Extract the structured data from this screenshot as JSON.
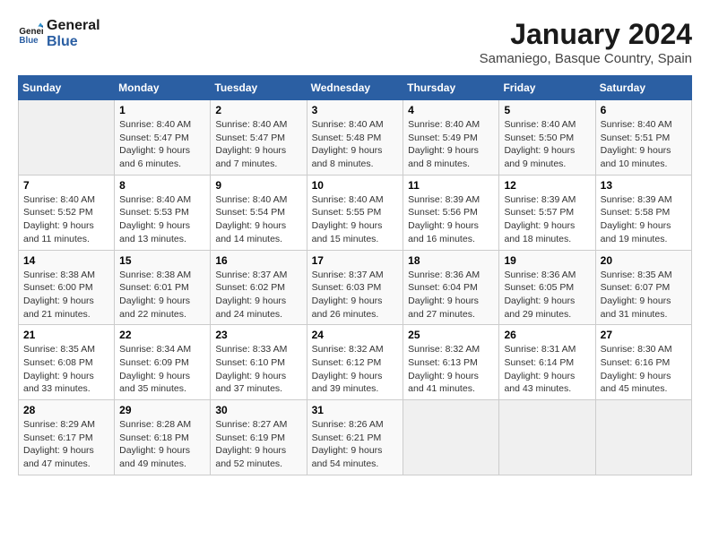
{
  "logo": {
    "line1": "General",
    "line2": "Blue"
  },
  "title": "January 2024",
  "subtitle": "Samaniego, Basque Country, Spain",
  "weekdays": [
    "Sunday",
    "Monday",
    "Tuesday",
    "Wednesday",
    "Thursday",
    "Friday",
    "Saturday"
  ],
  "weeks": [
    [
      {
        "day": "",
        "sunrise": "",
        "sunset": "",
        "daylight": ""
      },
      {
        "day": "1",
        "sunrise": "Sunrise: 8:40 AM",
        "sunset": "Sunset: 5:47 PM",
        "daylight": "Daylight: 9 hours and 6 minutes."
      },
      {
        "day": "2",
        "sunrise": "Sunrise: 8:40 AM",
        "sunset": "Sunset: 5:47 PM",
        "daylight": "Daylight: 9 hours and 7 minutes."
      },
      {
        "day": "3",
        "sunrise": "Sunrise: 8:40 AM",
        "sunset": "Sunset: 5:48 PM",
        "daylight": "Daylight: 9 hours and 8 minutes."
      },
      {
        "day": "4",
        "sunrise": "Sunrise: 8:40 AM",
        "sunset": "Sunset: 5:49 PM",
        "daylight": "Daylight: 9 hours and 8 minutes."
      },
      {
        "day": "5",
        "sunrise": "Sunrise: 8:40 AM",
        "sunset": "Sunset: 5:50 PM",
        "daylight": "Daylight: 9 hours and 9 minutes."
      },
      {
        "day": "6",
        "sunrise": "Sunrise: 8:40 AM",
        "sunset": "Sunset: 5:51 PM",
        "daylight": "Daylight: 9 hours and 10 minutes."
      }
    ],
    [
      {
        "day": "7",
        "sunrise": "Sunrise: 8:40 AM",
        "sunset": "Sunset: 5:52 PM",
        "daylight": "Daylight: 9 hours and 11 minutes."
      },
      {
        "day": "8",
        "sunrise": "Sunrise: 8:40 AM",
        "sunset": "Sunset: 5:53 PM",
        "daylight": "Daylight: 9 hours and 13 minutes."
      },
      {
        "day": "9",
        "sunrise": "Sunrise: 8:40 AM",
        "sunset": "Sunset: 5:54 PM",
        "daylight": "Daylight: 9 hours and 14 minutes."
      },
      {
        "day": "10",
        "sunrise": "Sunrise: 8:40 AM",
        "sunset": "Sunset: 5:55 PM",
        "daylight": "Daylight: 9 hours and 15 minutes."
      },
      {
        "day": "11",
        "sunrise": "Sunrise: 8:39 AM",
        "sunset": "Sunset: 5:56 PM",
        "daylight": "Daylight: 9 hours and 16 minutes."
      },
      {
        "day": "12",
        "sunrise": "Sunrise: 8:39 AM",
        "sunset": "Sunset: 5:57 PM",
        "daylight": "Daylight: 9 hours and 18 minutes."
      },
      {
        "day": "13",
        "sunrise": "Sunrise: 8:39 AM",
        "sunset": "Sunset: 5:58 PM",
        "daylight": "Daylight: 9 hours and 19 minutes."
      }
    ],
    [
      {
        "day": "14",
        "sunrise": "Sunrise: 8:38 AM",
        "sunset": "Sunset: 6:00 PM",
        "daylight": "Daylight: 9 hours and 21 minutes."
      },
      {
        "day": "15",
        "sunrise": "Sunrise: 8:38 AM",
        "sunset": "Sunset: 6:01 PM",
        "daylight": "Daylight: 9 hours and 22 minutes."
      },
      {
        "day": "16",
        "sunrise": "Sunrise: 8:37 AM",
        "sunset": "Sunset: 6:02 PM",
        "daylight": "Daylight: 9 hours and 24 minutes."
      },
      {
        "day": "17",
        "sunrise": "Sunrise: 8:37 AM",
        "sunset": "Sunset: 6:03 PM",
        "daylight": "Daylight: 9 hours and 26 minutes."
      },
      {
        "day": "18",
        "sunrise": "Sunrise: 8:36 AM",
        "sunset": "Sunset: 6:04 PM",
        "daylight": "Daylight: 9 hours and 27 minutes."
      },
      {
        "day": "19",
        "sunrise": "Sunrise: 8:36 AM",
        "sunset": "Sunset: 6:05 PM",
        "daylight": "Daylight: 9 hours and 29 minutes."
      },
      {
        "day": "20",
        "sunrise": "Sunrise: 8:35 AM",
        "sunset": "Sunset: 6:07 PM",
        "daylight": "Daylight: 9 hours and 31 minutes."
      }
    ],
    [
      {
        "day": "21",
        "sunrise": "Sunrise: 8:35 AM",
        "sunset": "Sunset: 6:08 PM",
        "daylight": "Daylight: 9 hours and 33 minutes."
      },
      {
        "day": "22",
        "sunrise": "Sunrise: 8:34 AM",
        "sunset": "Sunset: 6:09 PM",
        "daylight": "Daylight: 9 hours and 35 minutes."
      },
      {
        "day": "23",
        "sunrise": "Sunrise: 8:33 AM",
        "sunset": "Sunset: 6:10 PM",
        "daylight": "Daylight: 9 hours and 37 minutes."
      },
      {
        "day": "24",
        "sunrise": "Sunrise: 8:32 AM",
        "sunset": "Sunset: 6:12 PM",
        "daylight": "Daylight: 9 hours and 39 minutes."
      },
      {
        "day": "25",
        "sunrise": "Sunrise: 8:32 AM",
        "sunset": "Sunset: 6:13 PM",
        "daylight": "Daylight: 9 hours and 41 minutes."
      },
      {
        "day": "26",
        "sunrise": "Sunrise: 8:31 AM",
        "sunset": "Sunset: 6:14 PM",
        "daylight": "Daylight: 9 hours and 43 minutes."
      },
      {
        "day": "27",
        "sunrise": "Sunrise: 8:30 AM",
        "sunset": "Sunset: 6:16 PM",
        "daylight": "Daylight: 9 hours and 45 minutes."
      }
    ],
    [
      {
        "day": "28",
        "sunrise": "Sunrise: 8:29 AM",
        "sunset": "Sunset: 6:17 PM",
        "daylight": "Daylight: 9 hours and 47 minutes."
      },
      {
        "day": "29",
        "sunrise": "Sunrise: 8:28 AM",
        "sunset": "Sunset: 6:18 PM",
        "daylight": "Daylight: 9 hours and 49 minutes."
      },
      {
        "day": "30",
        "sunrise": "Sunrise: 8:27 AM",
        "sunset": "Sunset: 6:19 PM",
        "daylight": "Daylight: 9 hours and 52 minutes."
      },
      {
        "day": "31",
        "sunrise": "Sunrise: 8:26 AM",
        "sunset": "Sunset: 6:21 PM",
        "daylight": "Daylight: 9 hours and 54 minutes."
      },
      {
        "day": "",
        "sunrise": "",
        "sunset": "",
        "daylight": ""
      },
      {
        "day": "",
        "sunrise": "",
        "sunset": "",
        "daylight": ""
      },
      {
        "day": "",
        "sunrise": "",
        "sunset": "",
        "daylight": ""
      }
    ]
  ]
}
